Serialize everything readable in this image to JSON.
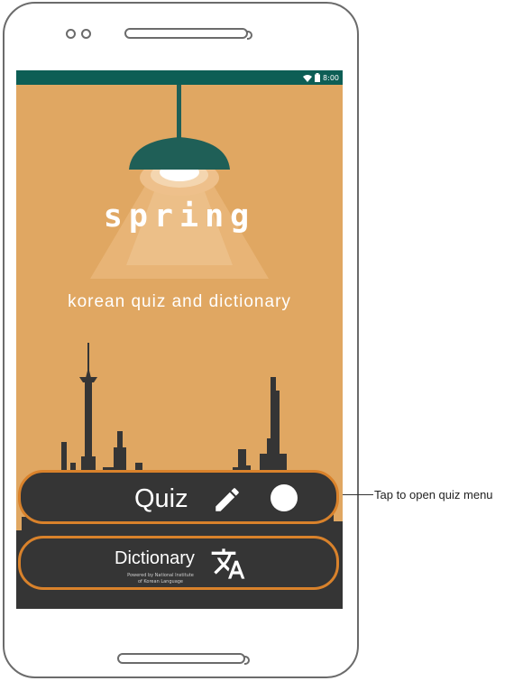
{
  "status_bar": {
    "time": "8:00",
    "wifi_icon": "wifi-icon",
    "battery_icon": "battery-icon"
  },
  "app": {
    "title": "spring",
    "subtitle": "korean quiz and dictionary"
  },
  "buttons": {
    "quiz": {
      "label": "Quiz",
      "icon": "pencil-icon"
    },
    "dictionary": {
      "label": "Dictionary",
      "subtext_line1": "Powered by National Institute",
      "subtext_line2": "of Korean Language",
      "icon": "translate-icon"
    }
  },
  "annotation": {
    "text": "Tap to open quiz menu"
  },
  "colors": {
    "screen_bg": "#e0a762",
    "status_bar": "#0d5e55",
    "lamp": "#1f5f57",
    "skyline": "#353535",
    "button_border": "#d9822b"
  }
}
